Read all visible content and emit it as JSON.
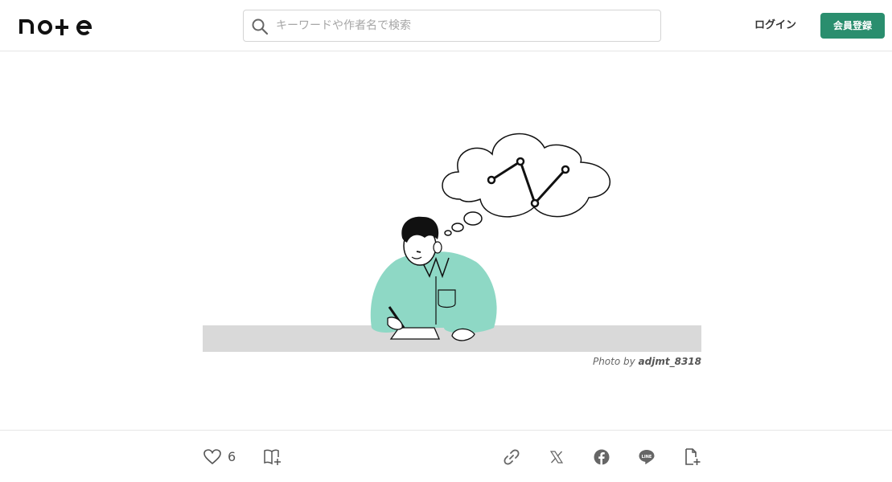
{
  "header": {
    "logo_text": "note",
    "search_placeholder": "キーワードや作者名で検索",
    "login_label": "ログイン",
    "signup_label": "会員登録",
    "signup_color": "#2a8e6e"
  },
  "hero": {
    "image_icon": "thinking-man-illustration",
    "credit_prefix": "Photo by",
    "credit_author": "adjmt_8318"
  },
  "actions": {
    "like_icon": "heart-icon",
    "like_count": "6",
    "magazine_icon": "add-to-magazine-icon",
    "share_icons": [
      "link-icon",
      "x-icon",
      "facebook-icon",
      "line-icon",
      "embed-icon"
    ],
    "line_label": "LINE"
  }
}
